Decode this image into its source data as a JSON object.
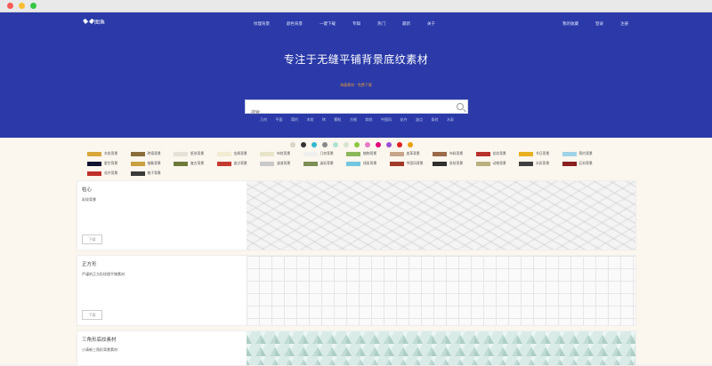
{
  "logo": {
    "text": "图鱼"
  },
  "nav": {
    "main": [
      "纹理背景",
      "颜色背景",
      "一键下载",
      "专辑",
      "热门",
      "最新",
      "关于"
    ],
    "right": [
      "我的收藏",
      "登录",
      "注册"
    ]
  },
  "hero": {
    "title": "专注于无缝平铺背景底纹素材",
    "subtitle": "海量素材 · 免费下载"
  },
  "search": {
    "placeholder": "搜索"
  },
  "hot_tags": [
    "几何",
    "平面",
    "简约",
    "木纹",
    "砖",
    "颗粒",
    "方格",
    "斜纹",
    "中国风",
    "花卉",
    "波点",
    "条纹",
    "水彩"
  ],
  "colors": [
    "#d9d6c4",
    "#333333",
    "#2fb9cf",
    "#888888",
    "#aee4d4",
    "#d7e3cf",
    "#8dc63f",
    "#e879c8",
    "#e0007a",
    "#9b4fd4",
    "#e02020",
    "#e8a10d"
  ],
  "categories": [
    {
      "label": "木纹背景",
      "color": "#d9a63a"
    },
    {
      "label": "砖墙背景",
      "color": "#8a6d3b"
    },
    {
      "label": "纸张背景",
      "color": "#e6e1d6"
    },
    {
      "label": "金属背景",
      "color": "#f1ecd2"
    },
    {
      "label": "布纹背景",
      "color": "#e8e4c8"
    },
    {
      "label": "几何背景",
      "color": "#efefef"
    },
    {
      "label": "植物背景",
      "color": "#8ab85a"
    },
    {
      "label": "皮革背景",
      "color": "#c7a58a"
    },
    {
      "label": "布料背景",
      "color": "#9a6a4a"
    },
    {
      "label": "花纹背景",
      "color": "#b7312b"
    },
    {
      "label": "节日背景",
      "color": "#e8b020"
    },
    {
      "label": "简约背景",
      "color": "#9fd3e8"
    },
    {
      "label": "星空背景",
      "color": "#111133"
    },
    {
      "label": "抽象背景",
      "color": "#c8a040"
    },
    {
      "label": "复古背景",
      "color": "#6d7a3a"
    },
    {
      "label": "波点背景",
      "color": "#c43a30"
    },
    {
      "label": "波浪背景",
      "color": "#c9c9c9"
    },
    {
      "label": "迷彩背景",
      "color": "#7c8f55"
    },
    {
      "label": "线条背景",
      "color": "#73c7df"
    },
    {
      "label": "中国风背景",
      "color": "#a23a2a"
    },
    {
      "label": "条纹背景",
      "color": "#303030"
    },
    {
      "label": "动物背景",
      "color": "#b9b080"
    },
    {
      "label": "水彩背景",
      "color": "#404040"
    },
    {
      "label": "石材背景",
      "color": "#8a2020"
    },
    {
      "label": "花卉背景",
      "color": "#c0302a"
    },
    {
      "label": "格子背景",
      "color": "#3a3a3a"
    }
  ],
  "cards": [
    {
      "title": "枯心",
      "desc": "彩纹背景",
      "button": "下载",
      "preview": "leaf"
    },
    {
      "title": "正方形",
      "desc": "严谨的正方形纹理平铺素材",
      "button": "下载",
      "preview": "grid"
    },
    {
      "title": "三角形底纹素材",
      "desc": "小清新三角形背景素材",
      "button": "下载",
      "preview": "triangle"
    }
  ]
}
